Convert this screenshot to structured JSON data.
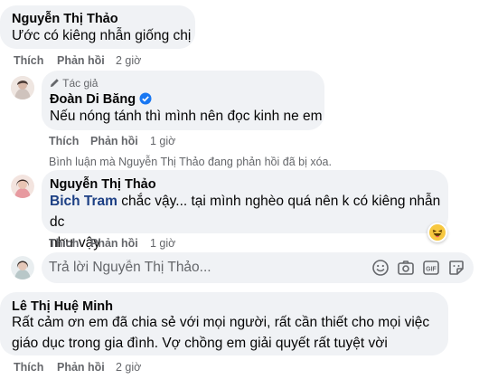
{
  "comments": [
    {
      "author": "Nguyễn Thị Thảo",
      "text": "Ước có kiêng nhẫn giống chị",
      "like": "Thích",
      "reply": "Phản hồi",
      "time": "2 giờ"
    },
    {
      "author_badge": "Tác giả",
      "author": "Đoàn Di Băng",
      "text": "Nếu nóng tánh thì mình nên đọc kinh ne em",
      "like": "Thích",
      "reply": "Phản hồi",
      "time": "1 giờ"
    },
    {
      "notice": "Bình luận mà Nguyễn Thị Thảo đang phản hồi đã bị xóa."
    },
    {
      "author": "Nguyễn Thị Thảo",
      "mention": "Bich Tram",
      "text_line1": " chắc vậy... tại mình nghèo quá nên k có kiêng nhẫn dc",
      "text_line2": "như vậy",
      "reaction": "😆",
      "like": "Thích",
      "reply": "Phản hồi",
      "time": "1 giờ"
    },
    {
      "author": "Lê Thị Huệ Minh",
      "text_line1": "Rất cảm ơn em đã chia sẻ với mọi người, rất cần thiết cho mọi việc",
      "text_line2": "giáo dục trong gia đình. Vợ chồng em giải quyết rất tuyệt vời",
      "like": "Thích",
      "reply": "Phản hồi",
      "time": "2 giờ"
    }
  ],
  "reply_box": {
    "placeholder": "Trả lời Nguyễn Thị Thảo...",
    "icons": [
      "emoji-icon",
      "camera-icon",
      "gif-icon",
      "sticker-icon"
    ]
  },
  "colors": {
    "bubble": "#f0f2f5",
    "secondary_text": "#65676b",
    "verified": "#1877f2",
    "mention": "#1c3f84"
  }
}
